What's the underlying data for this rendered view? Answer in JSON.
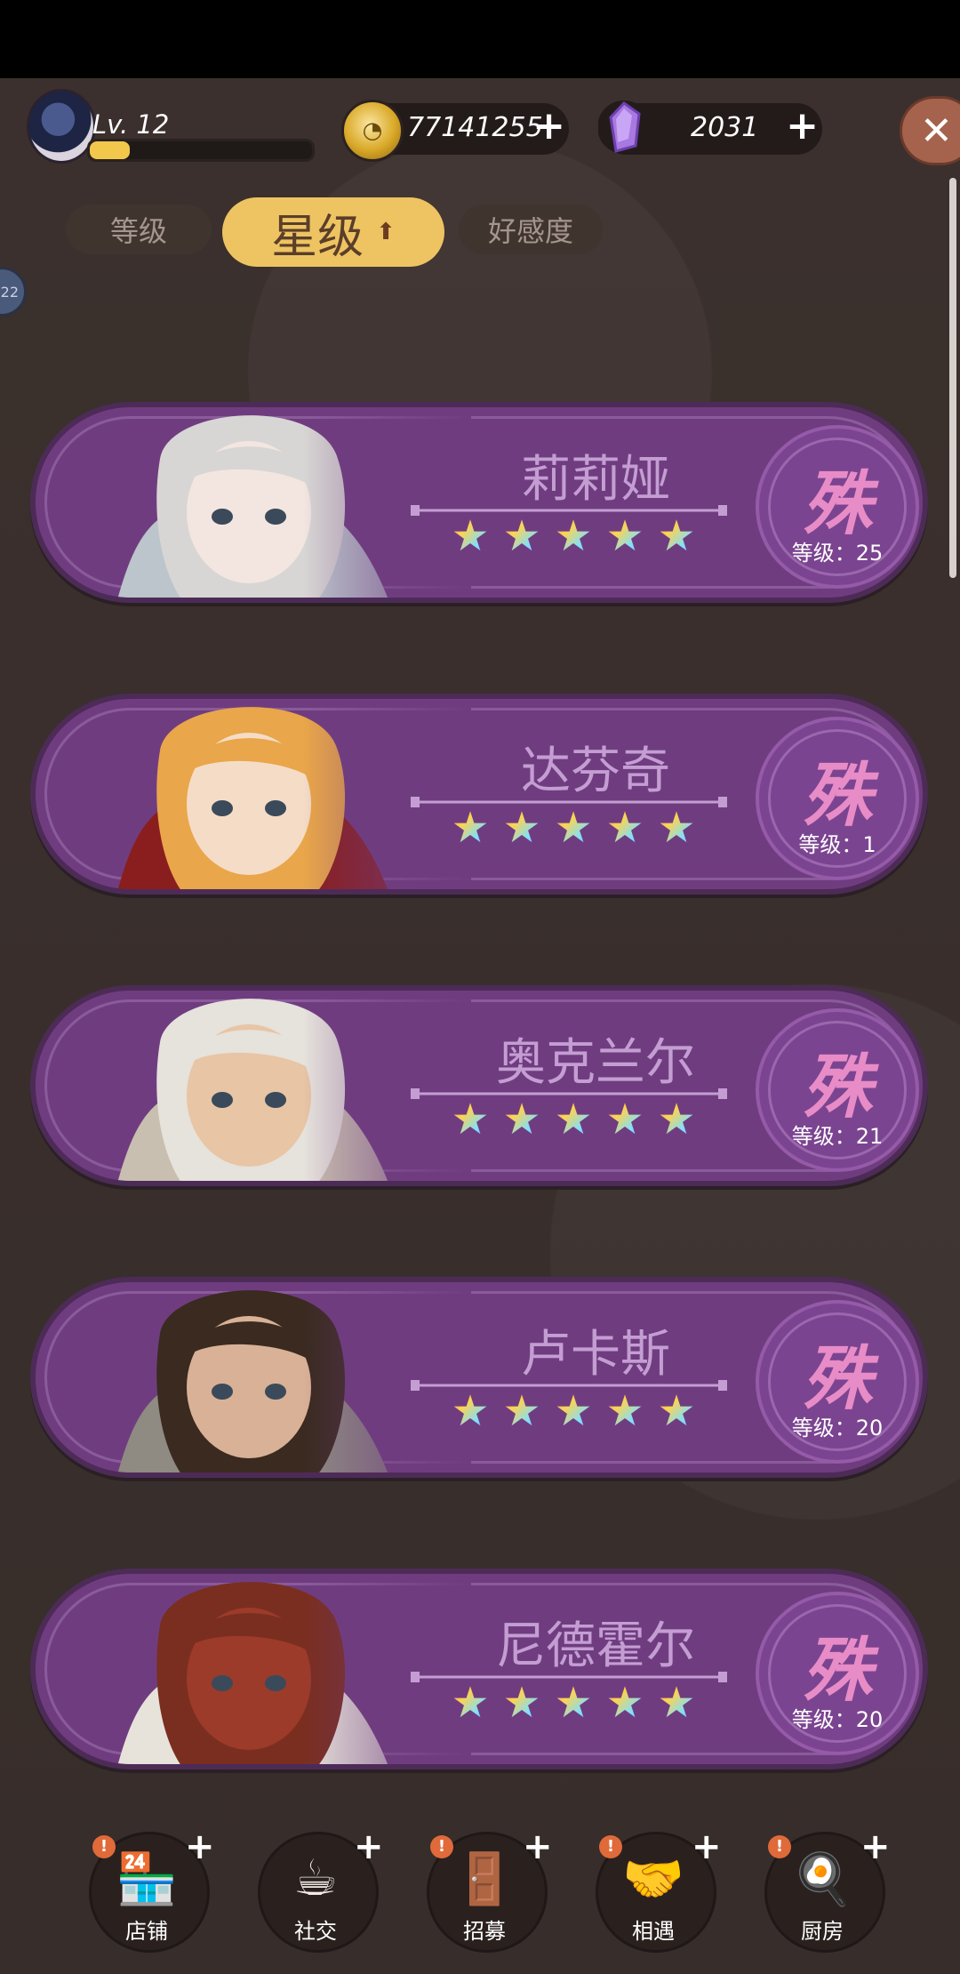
{
  "player": {
    "level_label": "Lv. 12",
    "xp_fraction": 0.18
  },
  "currency": {
    "coins": "77141255",
    "gems": "2031",
    "coin_icon": "coin-icon",
    "gem_icon": "purple-gem-icon"
  },
  "tabs": [
    {
      "label": "等级",
      "active": false
    },
    {
      "label": "星级",
      "active": true,
      "sort_icon": "up-arrow-icon"
    },
    {
      "label": "好感度",
      "active": false
    }
  ],
  "side_bubble": "22",
  "characters": [
    {
      "name": "莉莉娅",
      "stars": 5,
      "rank": "殊",
      "level_label": "等级：25"
    },
    {
      "name": "达芬奇",
      "stars": 5,
      "rank": "殊",
      "level_label": "等级：1"
    },
    {
      "name": "奥克兰尔",
      "stars": 5,
      "rank": "殊",
      "level_label": "等级：21"
    },
    {
      "name": "卢卡斯",
      "stars": 5,
      "rank": "殊",
      "level_label": "等级：20"
    },
    {
      "name": "尼德霍尔",
      "stars": 5,
      "rank": "殊",
      "level_label": "等级：20"
    }
  ],
  "nav": [
    {
      "label": "店铺",
      "icon": "shop-icon",
      "alert": "!"
    },
    {
      "label": "社交",
      "icon": "coffee-cup-icon",
      "alert": ""
    },
    {
      "label": "招募",
      "icon": "recruit-door-icon",
      "alert": "!"
    },
    {
      "label": "相遇",
      "icon": "handshake-icon",
      "alert": "!"
    },
    {
      "label": "厨房",
      "icon": "cooking-pan-icon",
      "alert": "!"
    }
  ],
  "colors": {
    "background": "#3a2f2c",
    "card": "#6f3d7f",
    "active_tab": "#eec462",
    "xp_fill": "#f1c84c",
    "close_button": "#a5634d"
  }
}
